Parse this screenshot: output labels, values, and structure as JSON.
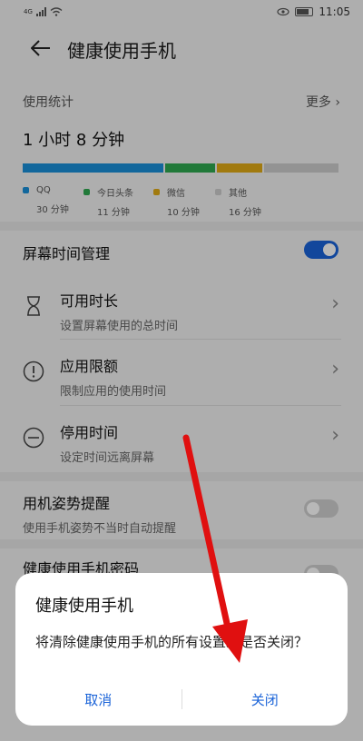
{
  "status": {
    "time": "11:05",
    "left": "4G"
  },
  "header": {
    "title": "健康使用手机"
  },
  "stats": {
    "label": "使用统计",
    "more": "更多",
    "total": "1 小时 8 分钟",
    "apps": [
      {
        "name": "QQ",
        "time": "30 分钟",
        "color": "#1a8fd8",
        "minutes": 30
      },
      {
        "name": "今日头条",
        "time": "11 分钟",
        "color": "#2fa84f",
        "minutes": 11
      },
      {
        "name": "微信",
        "time": "10 分钟",
        "color": "#e0a915",
        "minutes": 10
      },
      {
        "name": "其他",
        "time": "16 分钟",
        "color": "#cccccc",
        "minutes": 16
      }
    ]
  },
  "screen_time": {
    "label": "屏幕时间管理",
    "enabled": true
  },
  "items": [
    {
      "title": "可用时长",
      "subtitle": "设置屏幕使用的总时间"
    },
    {
      "title": "应用限额",
      "subtitle": "限制应用的使用时间"
    },
    {
      "title": "停用时间",
      "subtitle": "设定时间远离屏幕"
    }
  ],
  "posture": {
    "title": "用机姿势提醒",
    "subtitle": "使用手机姿势不当时自动提醒",
    "enabled": false
  },
  "password": {
    "title": "健康使用手机密码"
  },
  "dialog": {
    "title": "健康使用手机",
    "message": "将清除健康使用手机的所有设置。是否关闭？",
    "cancel": "取消",
    "confirm": "关闭"
  },
  "colors": {
    "accent": "#1a63d8",
    "arrow": "#e01010"
  }
}
